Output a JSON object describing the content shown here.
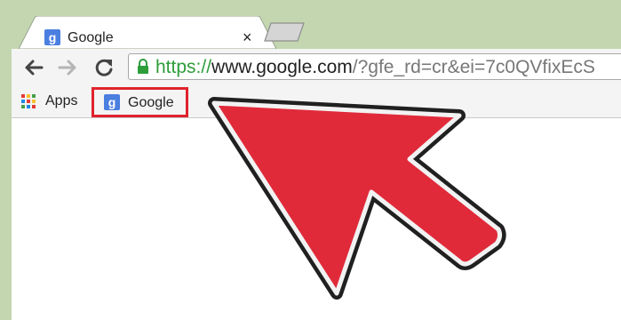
{
  "tab": {
    "title": "Google",
    "favicon_letter": "g",
    "close_glyph": "×"
  },
  "toolbar": {
    "url_scheme": "https://",
    "url_host": "www.google.com",
    "url_rest": "/?gfe_rd=cr&ei=7c0QVfixEcS"
  },
  "bookmarks": {
    "apps_label": "Apps",
    "items": [
      {
        "label": "Google",
        "favicon_letter": "g"
      }
    ]
  },
  "colors": {
    "frame": "#c3d6b0",
    "highlight_box": "#e0222d",
    "arrow_fill": "#e02a3a",
    "https_green": "#2e9d3a",
    "favicon_blue": "#4a7fe0"
  }
}
